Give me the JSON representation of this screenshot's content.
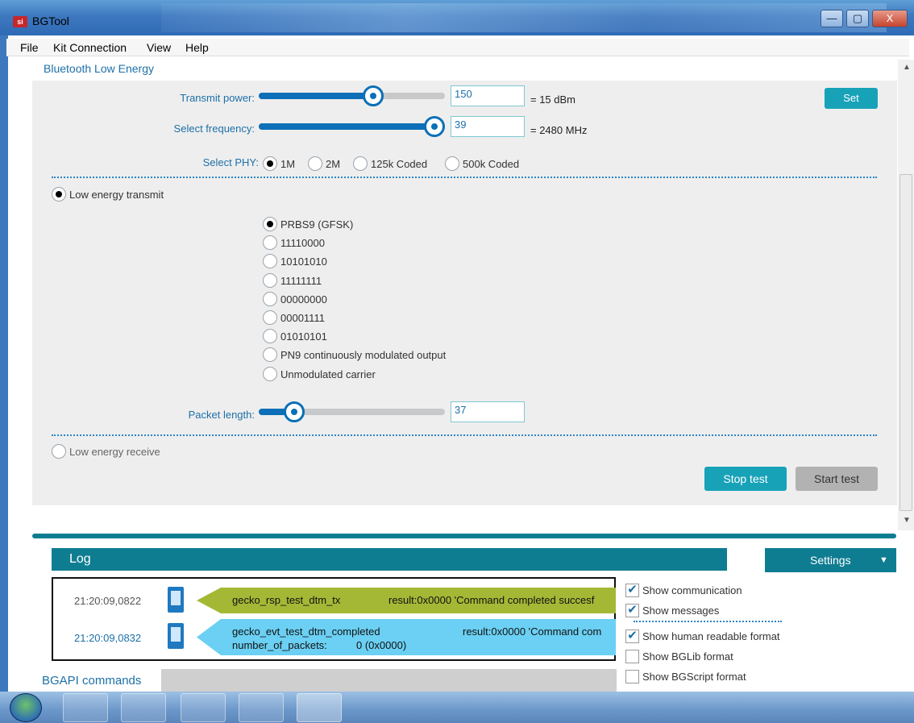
{
  "window": {
    "title": "BGTool",
    "min_glyph": "—",
    "max_glyph": "▢",
    "close_glyph": "X"
  },
  "menu": [
    "File",
    "Kit Connection",
    "View",
    "Help"
  ],
  "tab": "Bluetooth Low Energy",
  "transmit": {
    "label": "Transmit power:",
    "value": "150",
    "eq": "= 15 dBm",
    "level": 0.63
  },
  "frequency": {
    "label": "Select frequency:",
    "value": "39",
    "eq": "= 2480 MHz",
    "level": 1.0
  },
  "set_button": "Set",
  "phy": {
    "label": "Select PHY:",
    "options": [
      "1M",
      "2M",
      "125k Coded",
      "500k Coded"
    ],
    "selected": "1M"
  },
  "le_transmit": "Low energy transmit",
  "patterns": [
    "PRBS9 (GFSK)",
    "11110000",
    "10101010",
    "11111111",
    "00000000",
    "00001111",
    "01010101",
    "PN9 continuously modulated output",
    "Unmodulated carrier"
  ],
  "packet_length": {
    "label": "Packet length:",
    "value": "37",
    "level": 0.15
  },
  "le_receive": "Low energy receive",
  "stop_button": "Stop test",
  "start_button": "Start test",
  "log": {
    "title": "Log",
    "settings": "Settings",
    "rows": [
      {
        "time": "21:20:09,0822",
        "cmd": "gecko_rsp_test_dtm_tx",
        "result": "result:0x0000 'Command completed succesf"
      },
      {
        "time": "21:20:09,0832",
        "cmd": "gecko_evt_test_dtm_completed",
        "result": "result:0x0000 'Command com",
        "extra_label": "number_of_packets:",
        "extra_value": "0 (0x0000)"
      }
    ]
  },
  "settings_menu": [
    {
      "label": "Show communication",
      "checked": true
    },
    {
      "label": "Show messages",
      "checked": true
    },
    {
      "label": "Show human readable format",
      "checked": true
    },
    {
      "label": "Show BGLib format",
      "checked": false
    },
    {
      "label": "Show BGScript format",
      "checked": false
    }
  ],
  "check_glyph": "✔",
  "bgapi_label": "BGAPI commands",
  "colors": {
    "teal": "#0f7d91",
    "blue": "#0c6fb7",
    "green_msg": "#a5b836",
    "blue_msg": "#6bd0f3"
  }
}
